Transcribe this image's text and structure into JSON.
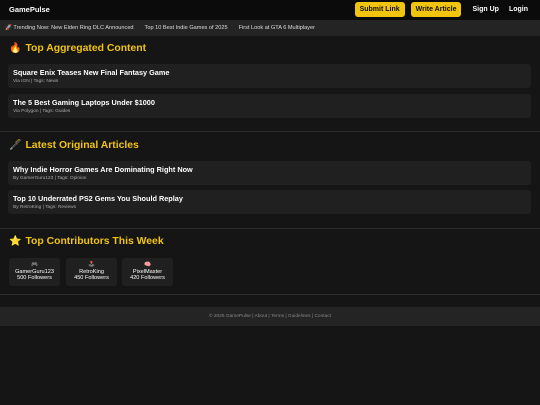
{
  "header": {
    "brand": "GamePulse",
    "submit_label": "Submit Link",
    "write_label": "Write Article",
    "signup_label": "Sign Up",
    "login_label": "Login"
  },
  "ticker": {
    "items": [
      "🚀 Trending Now: New Elden Ring DLC Announced",
      "Top 10 Best Indie Games of 2025",
      "First Look at GTA 6 Multiplayer"
    ]
  },
  "aggregated": {
    "icon": "🔥",
    "title": "Top Aggregated Content",
    "items": [
      {
        "title": "Square Enix Teases New Final Fantasy Game",
        "meta": "Via IGN | Tags: News"
      },
      {
        "title": "The 5 Best Gaming Laptops Under $1000",
        "meta": "Via Polygon | Tags: Guides"
      }
    ]
  },
  "original": {
    "icon": "🖋️",
    "title": "Latest Original Articles",
    "items": [
      {
        "title": "Why Indie Horror Games Are Dominating Right Now",
        "meta": "By GamerGuru123 | Tags: Opinion"
      },
      {
        "title": "Top 10 Underrated PS2 Gems You Should Replay",
        "meta": "By RetroKing | Tags: Reviews"
      }
    ]
  },
  "contributors": {
    "icon": "⭐",
    "title": "Top Contributors This Week",
    "items": [
      {
        "icon": "🎮",
        "name": "GamerGuru123",
        "followers": "500 Followers"
      },
      {
        "icon": "🕹️",
        "name": "RetroKing",
        "followers": "450 Followers"
      },
      {
        "icon": "🧠",
        "name": "PixelMaster",
        "followers": "420 Followers"
      }
    ]
  },
  "footer": {
    "text": "© 2025 GamePulse | About | Terms | Guidelines | Contact"
  }
}
